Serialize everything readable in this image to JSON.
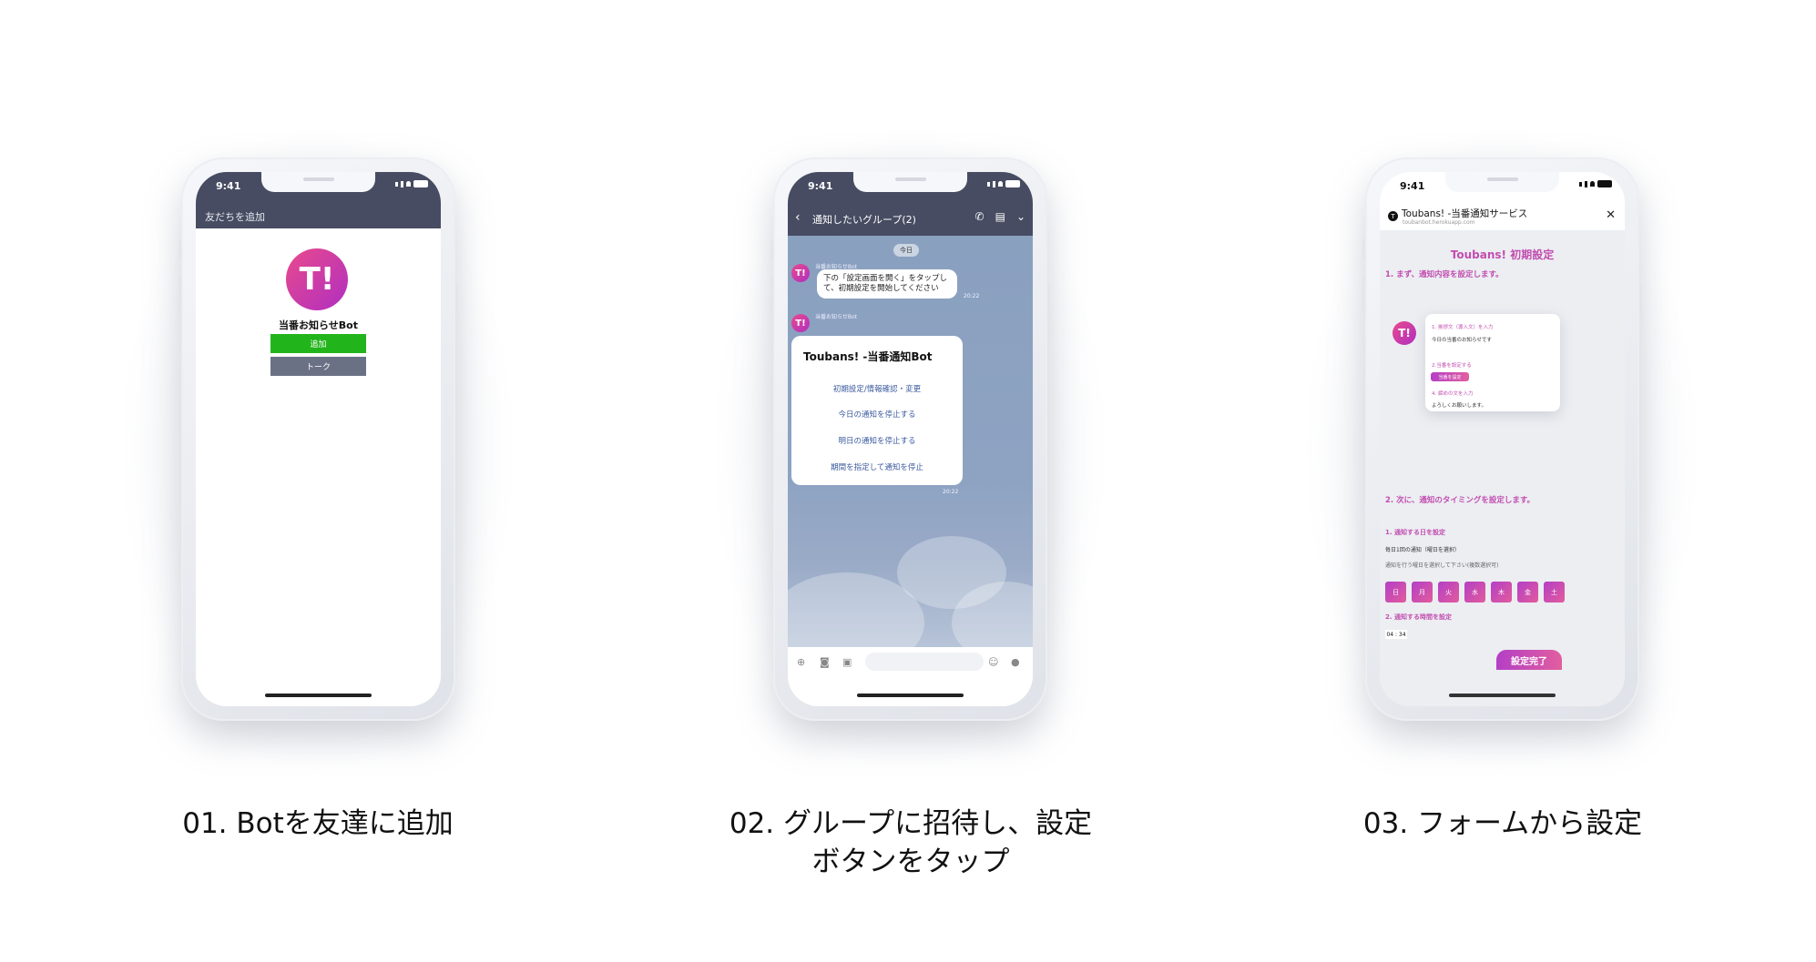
{
  "steps": [
    {
      "caption": "01. Botを友達に追加"
    },
    {
      "caption_line1": "02. グループに招待し、設定",
      "caption_line2": "ボタンをタップ"
    },
    {
      "caption": "03. フォームから設定"
    }
  ],
  "phone_status": {
    "time": "9:41"
  },
  "phone1": {
    "header_title": "友だちを追加",
    "avatar_text": "T!",
    "bot_name": "当番お知らせBot",
    "add_button": "追加",
    "talk_button": "トーク"
  },
  "phone2": {
    "back_icon": "chevron-left-icon",
    "group_title": "通知したいグループ(2)",
    "date_label": "今日",
    "avatar_text": "T!",
    "sender_name": "当番お知らせBot",
    "message_text": "下の「設定画面を開く」をタップして、初期設定を開始してください",
    "message_time": "20:22",
    "card_title": "Toubans! -当番通知Bot",
    "card_actions": [
      "初期設定/情報確認・変更",
      "今日の通知を停止する",
      "明日の通知を停止する",
      "期間を指定して通知を停止"
    ],
    "card_time": "20:22"
  },
  "phone3": {
    "site_title": "Toubans! -当番通知サービス",
    "site_url": "toubanbot.herokuapp.com",
    "close_icon": "close-icon",
    "page_title": "Toubans! 初期設定",
    "section1": "1. まず、通知内容を設定します。",
    "preview": {
      "label1": "1. 挨拶文（導入文）を入力",
      "value1": "今日の当番のお知らせです",
      "label2": "2.当番を設定する",
      "button": "当番を設定",
      "label3": "4. 締めの文を入力",
      "value3": "よろしくお願いします。"
    },
    "section2": "2. 次に、通知のタイミングを設定します。",
    "sub1": "1. 通知する日を設定",
    "daily_label": "毎日1回の通知（曜日を選択）",
    "days_hint": "通知を行う曜日を選択して下さい(複数選択可)",
    "days": [
      "日",
      "月",
      "火",
      "水",
      "木",
      "金",
      "土"
    ],
    "sub2": "2. 通知する時間を設定",
    "time_value": "04 : 34",
    "submit": "設定完了"
  },
  "colors": {
    "line_header": "#474c62",
    "line_green": "#22b51b",
    "accent_pink": "#c24db0",
    "chat_bg": "#8aa0bf"
  }
}
